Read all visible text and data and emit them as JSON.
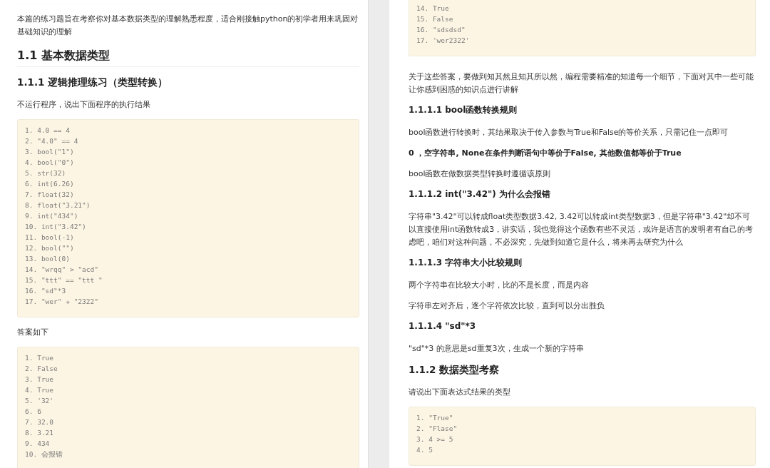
{
  "pages": [
    {
      "blocks": [
        {
          "kind": "paragraph",
          "text": "本篇的练习题旨在考察你对基本数据类型的理解熟悉程度，适合刚接触python的初学者用来巩固对基础知识的理解"
        },
        {
          "kind": "h2",
          "text": "1.1 基本数据类型"
        },
        {
          "kind": "h3",
          "text": "1.1.1 逻辑推理练习（类型转换）"
        },
        {
          "kind": "paragraph",
          "text": "不运行程序，说出下面程序的执行结果"
        },
        {
          "kind": "code",
          "lines": [
            "1. 4.0 == 4",
            "2. \"4.0\" == 4",
            "3. bool(\"1\")",
            "4. bool(\"0\")",
            "5. str(32)",
            "6. int(6.26)",
            "7. float(32)",
            "8. float(\"3.21\")",
            "9. int(\"434\")",
            "10. int(\"3.42\")",
            "11. bool(-1)",
            "12. bool(\"\")",
            "13. bool(0)",
            "14. \"wrqq\" > \"acd\"",
            "15. \"ttt\" == \"ttt \"",
            "16. \"sd\"*3",
            "17. \"wer\" + \"2322\""
          ]
        },
        {
          "kind": "paragraph",
          "text": "答案如下"
        },
        {
          "kind": "code",
          "lines": [
            "1. True",
            "2. False",
            "3. True",
            "4. True",
            "5. '32'",
            "6. 6",
            "7. 32.0",
            "8. 3.21",
            "9. 434",
            "10. 会报错"
          ]
        }
      ]
    },
    {
      "blocks": [
        {
          "kind": "code",
          "lines": [
            "14. True",
            "15. False",
            "16. \"sdsdsd\"",
            "17. 'wer2322'"
          ]
        },
        {
          "kind": "paragraph",
          "text": "关于这些答案，要做到知其然且知其所以然，编程需要精准的知道每一个细节，下面对其中一些可能让你感到困惑的知识点进行讲解"
        },
        {
          "kind": "h4",
          "text": "1.1.1.1 bool函数转换规则"
        },
        {
          "kind": "paragraph",
          "text": "bool函数进行转换时，其结果取决于传入参数与True和False的等价关系，只需记住一点即可"
        },
        {
          "kind": "bold",
          "text": "0 ，空字符串, None在条件判断语句中等价于False, 其他数值都等价于True"
        },
        {
          "kind": "paragraph",
          "text": "bool函数在做数据类型转换时遵循该原则"
        },
        {
          "kind": "h4",
          "text": "1.1.1.2 int(\"3.42\") 为什么会报错"
        },
        {
          "kind": "paragraph",
          "text": "字符串\"3.42\"可以转成float类型数据3.42, 3.42可以转成int类型数据3，但是字符串\"3.42\"却不可以直接使用int函数转成3，讲实话，我也觉得这个函数有些不灵活，或许是语言的发明者有自己的考虑吧，咱们对这种问题，不必深究，先做到知道它是什么，将来再去研究为什么"
        },
        {
          "kind": "h4",
          "text": "1.1.1.3 字符串大小比较规则"
        },
        {
          "kind": "paragraph",
          "text": "两个字符串在比较大小时，比的不是长度，而是内容"
        },
        {
          "kind": "paragraph",
          "text": "字符串左对齐后，逐个字符依次比较，直到可以分出胜负"
        },
        {
          "kind": "h4",
          "text": "1.1.1.4 \"sd\"*3"
        },
        {
          "kind": "paragraph",
          "text": "\"sd\"*3 的意思是sd重复3次，生成一个新的字符串"
        },
        {
          "kind": "h3",
          "text": "1.1.2 数据类型考察"
        },
        {
          "kind": "paragraph",
          "text": "请说出下面表达式结果的类型"
        },
        {
          "kind": "code",
          "lines": [
            "1. \"True\"",
            "2. \"Flase\"",
            "3. 4 >= 5",
            "4. 5"
          ]
        }
      ]
    }
  ]
}
